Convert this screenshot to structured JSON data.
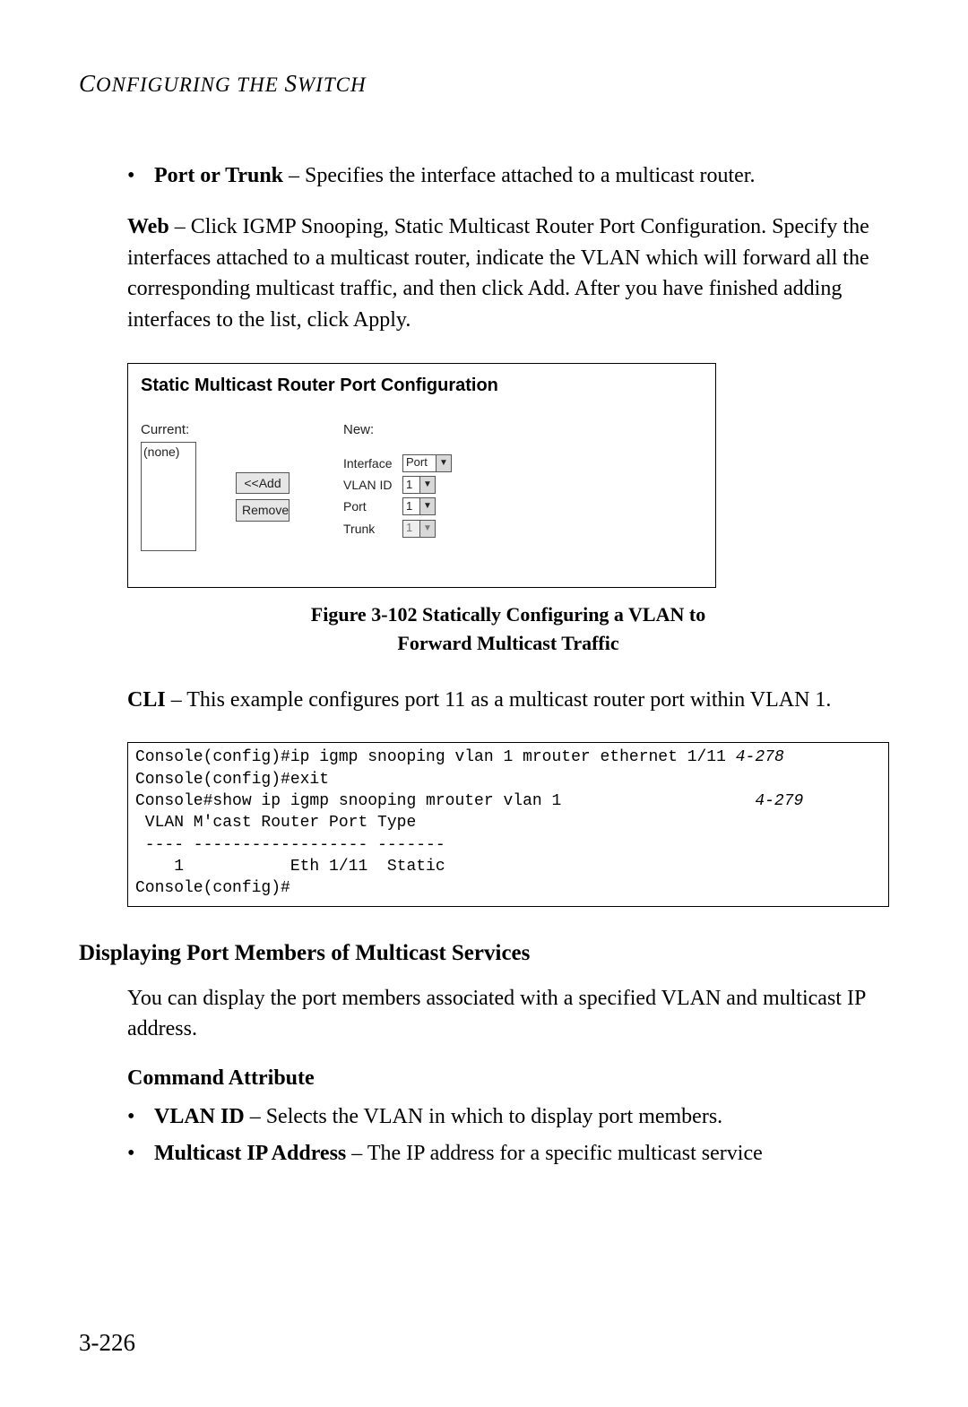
{
  "header": "Configuring the Switch",
  "topBullet": {
    "label": "Port or Trunk",
    "text": " – Specifies the interface attached to a multicast router."
  },
  "webPara": {
    "lead": "Web",
    "text": " – Click IGMP Snooping, Static Multicast Router Port Configuration. Specify the interfaces attached to a multicast router, indicate the VLAN which will forward all the corresponding multicast traffic, and then click Add. After you have finished adding interfaces to the list, click Apply."
  },
  "shot": {
    "title": "Static Multicast Router Port Configuration",
    "currentLabel": "Current:",
    "currentValue": "(none)",
    "addLabel": "<<Add",
    "removeLabel": "Remove",
    "newLabel": "New:",
    "rows": {
      "interface": {
        "label": "Interface",
        "value": "Port"
      },
      "vlan": {
        "label": "VLAN ID",
        "value": "1"
      },
      "port": {
        "label": "Port",
        "value": "1"
      },
      "trunk": {
        "label": "Trunk",
        "value": "1"
      }
    }
  },
  "figure": {
    "line1": "Figure 3-102  Statically Configuring a VLAN to",
    "line2": "Forward Multicast Traffic"
  },
  "cliPara": {
    "lead": "CLI",
    "text": " – This example configures port 11 as a multicast router port within VLAN 1."
  },
  "cli": {
    "l1a": "Console(config)#ip igmp snooping vlan 1 mrouter ethernet 1/11",
    "l1b": "4-278",
    "l2": "Console(config)#exit",
    "l3a": "Console#show ip igmp snooping mrouter vlan 1",
    "l3b": "4-279",
    "l4": " VLAN M'cast Router Port Type",
    "l5": " ---- ------------------ -------",
    "l6": "    1           Eth 1/11  Static",
    "l7": "Console(config)#"
  },
  "section2": {
    "title": "Displaying Port Members of Multicast Services",
    "intro": "You can display the port members associated with a specified VLAN and multicast IP address.",
    "sub": "Command Attribute",
    "attrs": [
      {
        "label": "VLAN ID",
        "text": " – Selects the VLAN in which to display port members."
      },
      {
        "label": "Multicast IP Address",
        "text": " – The IP address for a specific multicast service"
      }
    ]
  },
  "pageNumber": "3-226"
}
